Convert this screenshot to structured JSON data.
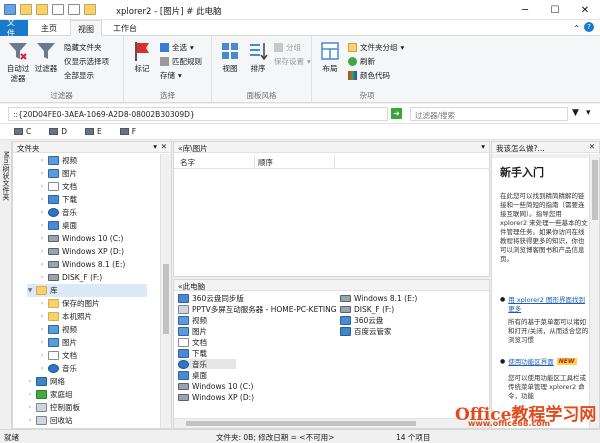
{
  "window": {
    "title": "xplorer2 - [图片] # 此电脑"
  },
  "tabs": [
    "文件",
    "主页",
    "视图",
    "工作台"
  ],
  "ribbon": {
    "filter_group": {
      "btn1": "自动过滤器",
      "btn2": "过滤器",
      "items": [
        "隐藏文件夹",
        "仅显示选择项",
        "全部显示"
      ],
      "label": "过滤器"
    },
    "select_group": {
      "btn1": "标记",
      "items": [
        "全选",
        "匹配规则",
        "存储"
      ],
      "label": "选择"
    },
    "pane_group": {
      "btn1": "视图",
      "btn2": "排序",
      "items": [
        "分组",
        "保存设置"
      ],
      "label": "面板风格"
    },
    "misc_group": {
      "btn1": "布局",
      "items": [
        "文件夹分组",
        "刷新",
        "颜色代码"
      ],
      "label": "杂项"
    }
  },
  "address": {
    "path": "::{20D04FE0-3AEA-1069-A2D8-08002B30309D}",
    "search_placeholder": "过滤器/搜索"
  },
  "drives": [
    "C",
    "D",
    "E",
    "F"
  ],
  "left_pane": {
    "header": "文件夹",
    "side_tab": "Mini树状文件夹",
    "items": [
      {
        "label": "视频",
        "icon": "video-folder"
      },
      {
        "label": "图片",
        "icon": "pictures-folder"
      },
      {
        "label": "文档",
        "icon": "documents-folder"
      },
      {
        "label": "下载",
        "icon": "downloads-folder"
      },
      {
        "label": "音乐",
        "icon": "music-folder"
      },
      {
        "label": "桌面",
        "icon": "desktop-folder"
      },
      {
        "label": "Windows 10 (C:)",
        "icon": "drive"
      },
      {
        "label": "Windows XP (D:)",
        "icon": "drive"
      },
      {
        "label": "Windows 8.1 (E:)",
        "icon": "drive"
      },
      {
        "label": "DISK_F (F:)",
        "icon": "drive"
      },
      {
        "label": "库",
        "icon": "library"
      },
      {
        "label": "保存的图片",
        "icon": "folder"
      },
      {
        "label": "本机照片",
        "icon": "folder"
      },
      {
        "label": "视频",
        "icon": "video-folder"
      },
      {
        "label": "图片",
        "icon": "pictures-folder"
      },
      {
        "label": "文档",
        "icon": "documents-folder"
      },
      {
        "label": "音乐",
        "icon": "music-folder"
      },
      {
        "label": "网络",
        "icon": "network"
      },
      {
        "label": "家庭组",
        "icon": "homegroup"
      },
      {
        "label": "控制面板",
        "icon": "control-panel"
      },
      {
        "label": "回收站",
        "icon": "recycle-bin"
      }
    ]
  },
  "top_pane": {
    "header": "«库\\图片",
    "columns": [
      "名字",
      "顺序"
    ]
  },
  "bottom_pane": {
    "header": "«此电脑",
    "items_left": [
      "360云盘同步版",
      "PPTV多屏互动服务器 - HOME-PC-KETING",
      "视频",
      "图片",
      "文档",
      "下载",
      "音乐",
      "桌面",
      "Windows 10 (C:)",
      "Windows XP (D:)"
    ],
    "items_right": [
      "Windows 8.1 (E:)",
      "DISK_F (F:)",
      "360云盘",
      "百度云管家"
    ]
  },
  "right_pane": {
    "header": "我该怎么做?...",
    "title": "新手入门",
    "para1": "在此您可以找到精简精解的链接和一些简短的指南（需要连接互联网）。指导您用xplorer2 来处理一些基本的文件管理任务。如果你访问在线教程将获得更多的知识，你也可以浏览博客图书和产品信息页。",
    "link1": "用 xplorer2 图形界面找到更多",
    "para2": "所有的基于菜单都可以诸如和打开/关闭，从而适合您的浏览习惯",
    "link2": "使用功能区界面",
    "new_badge": "NEW",
    "para3": "您可以使用功能区工具栏或传统菜单管理 xplorer2 命令，功能"
  },
  "status": {
    "left": "就绪",
    "middle": "文件夹: 0B; 修改日期 = <不可用>",
    "count": "14 个项目"
  },
  "watermark": {
    "line1": "Office教程学习网",
    "line2": "www.office68.com"
  }
}
